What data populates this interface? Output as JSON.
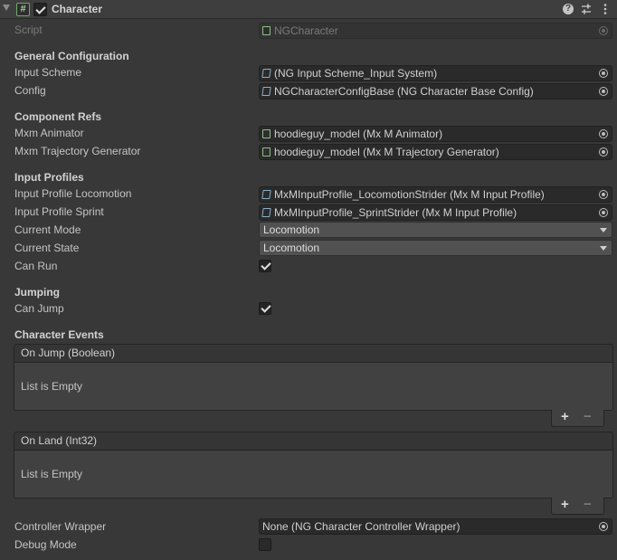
{
  "header": {
    "title": "Character",
    "help_glyph": "?",
    "enabled": true
  },
  "script": {
    "label": "Script",
    "value": "NGCharacter"
  },
  "general": {
    "heading": "General Configuration",
    "input_scheme_label": "Input Scheme",
    "input_scheme_value": "(NG Input Scheme_Input System)",
    "config_label": "Config",
    "config_value": "NGCharacterConfigBase (NG Character Base Config)"
  },
  "component_refs": {
    "heading": "Component Refs",
    "animator_label": "Mxm Animator",
    "animator_value": "hoodieguy_model (Mx M Animator)",
    "trajectory_label": "Mxm Trajectory Generator",
    "trajectory_value": "hoodieguy_model (Mx M Trajectory Generator)"
  },
  "input_profiles": {
    "heading": "Input Profiles",
    "locomotion_label": "Input Profile Locomotion",
    "locomotion_value": "MxMInputProfile_LocomotionStrider (Mx M Input Profile)",
    "sprint_label": "Input Profile Sprint",
    "sprint_value": "MxMInputProfile_SprintStrider (Mx M Input Profile)",
    "mode_label": "Current Mode",
    "mode_value": "Locomotion",
    "state_label": "Current State",
    "state_value": "Locomotion",
    "can_run_label": "Can Run",
    "can_run": true
  },
  "jumping": {
    "heading": "Jumping",
    "can_jump_label": "Can Jump",
    "can_jump": true
  },
  "events": {
    "heading": "Character Events",
    "on_jump_title": "On Jump (Boolean)",
    "on_jump_body": "List is Empty",
    "on_land_title": "On Land (Int32)",
    "on_land_body": "List is Empty",
    "add_glyph": "+",
    "remove_glyph": "−"
  },
  "footer": {
    "wrapper_label": "Controller Wrapper",
    "wrapper_value": "None (NG Character Controller Wrapper)",
    "debug_label": "Debug Mode",
    "debug": false
  }
}
